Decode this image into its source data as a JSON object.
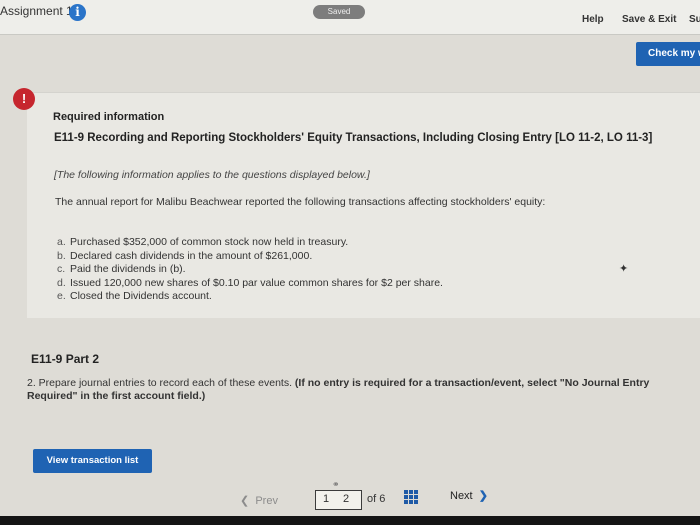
{
  "header": {
    "assignment_title": "Assignment 1",
    "info_glyph": "i",
    "saved_label": "Saved",
    "help_label": "Help",
    "save_exit_label": "Save & Exit",
    "submit_label": "Su"
  },
  "check_button_label": "Check my w",
  "required_info": {
    "alert_glyph": "!",
    "label": "Required information",
    "heading": "E11-9 Recording and Reporting Stockholders' Equity Transactions, Including Closing Entry [LO 11-2, LO 11-3]",
    "note": "[The following information applies to the questions displayed below.]",
    "intro": "The annual report for Malibu Beachwear reported the following transactions affecting stockholders' equity:",
    "items": [
      {
        "letter": "a.",
        "text": "Purchased $352,000 of common stock now held in treasury."
      },
      {
        "letter": "b.",
        "text": "Declared cash dividends in the amount of $261,000."
      },
      {
        "letter": "c.",
        "text": "Paid the dividends in (b)."
      },
      {
        "letter": "d.",
        "text": "Issued 120,000 new shares of $0.10 par value common shares for $2 per share."
      },
      {
        "letter": "e.",
        "text": "Closed the Dividends account."
      }
    ]
  },
  "part_title": "E11-9 Part 2",
  "instruction": {
    "text": "2. Prepare journal entries to record each of these events. ",
    "bold": "(If no entry is required for a transaction/event, select \"No Journal Entry Required\" in the first account field.)"
  },
  "view_transaction_label": "View transaction list",
  "pagination": {
    "prev_label": "Prev",
    "page_1": "1",
    "page_2": "2",
    "of_total": "of 6",
    "next_label": "Next"
  },
  "colors": {
    "accent_blue": "#1f63b3",
    "alert_red": "#c6262e"
  }
}
